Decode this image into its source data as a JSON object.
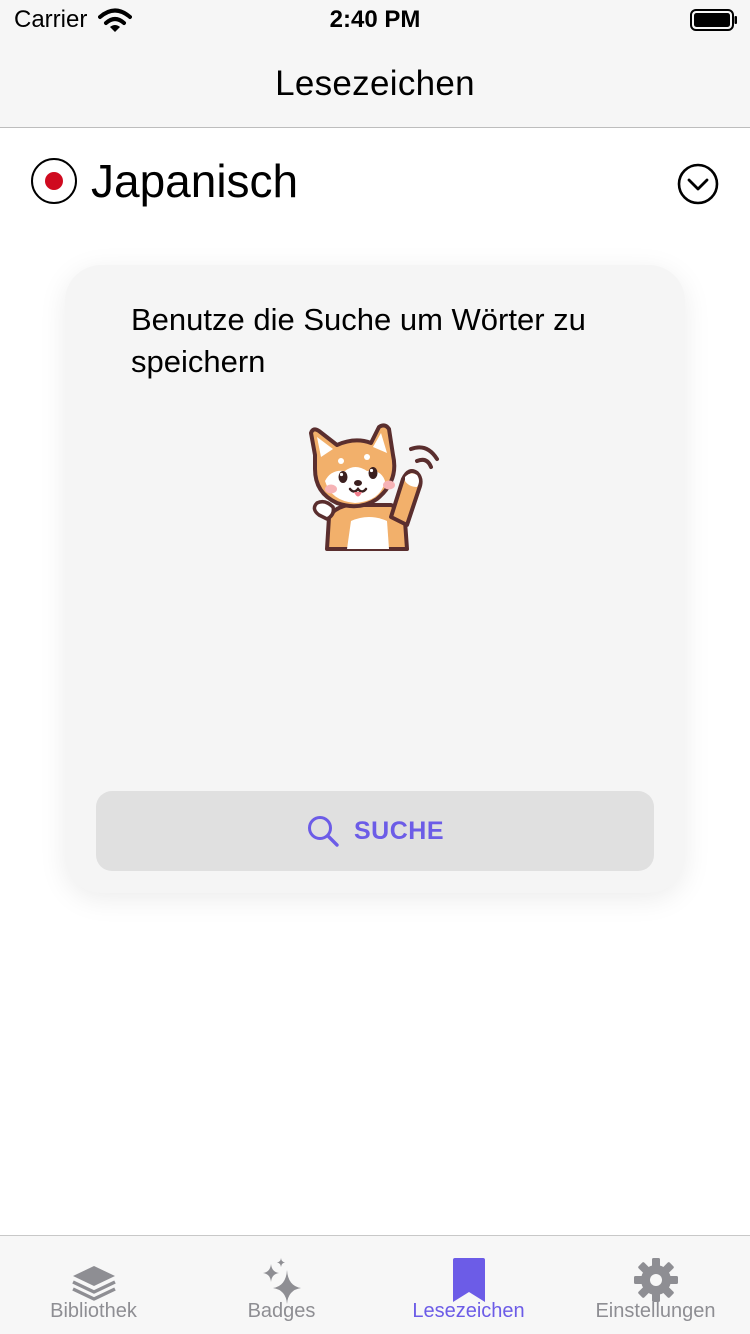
{
  "status_bar": {
    "carrier": "Carrier",
    "time": "2:40 PM"
  },
  "nav": {
    "title": "Lesezeichen"
  },
  "language": {
    "name": "Japanisch",
    "flag_icon": "japan-flag-icon",
    "expand_icon": "chevron-down-circle-icon"
  },
  "card": {
    "message": "Benutze die Suche um Wörter zu speichern",
    "mascot": "shiba-dog-waving-illustration",
    "search_button_label": "SUCHE",
    "search_icon": "search-icon"
  },
  "tabs": [
    {
      "label": "Bibliothek",
      "icon": "layers-icon",
      "active": false
    },
    {
      "label": "Badges",
      "icon": "sparkles-icon",
      "active": false
    },
    {
      "label": "Lesezeichen",
      "icon": "bookmark-icon",
      "active": true
    },
    {
      "label": "Einstellungen",
      "icon": "gear-icon",
      "active": false
    }
  ],
  "colors": {
    "accent": "#6c5ce7",
    "inactive_tab": "#8e8e93",
    "flag_red": "#cf0a1f",
    "card_background": "#f5f5f5",
    "button_background": "#e0e0e0"
  }
}
